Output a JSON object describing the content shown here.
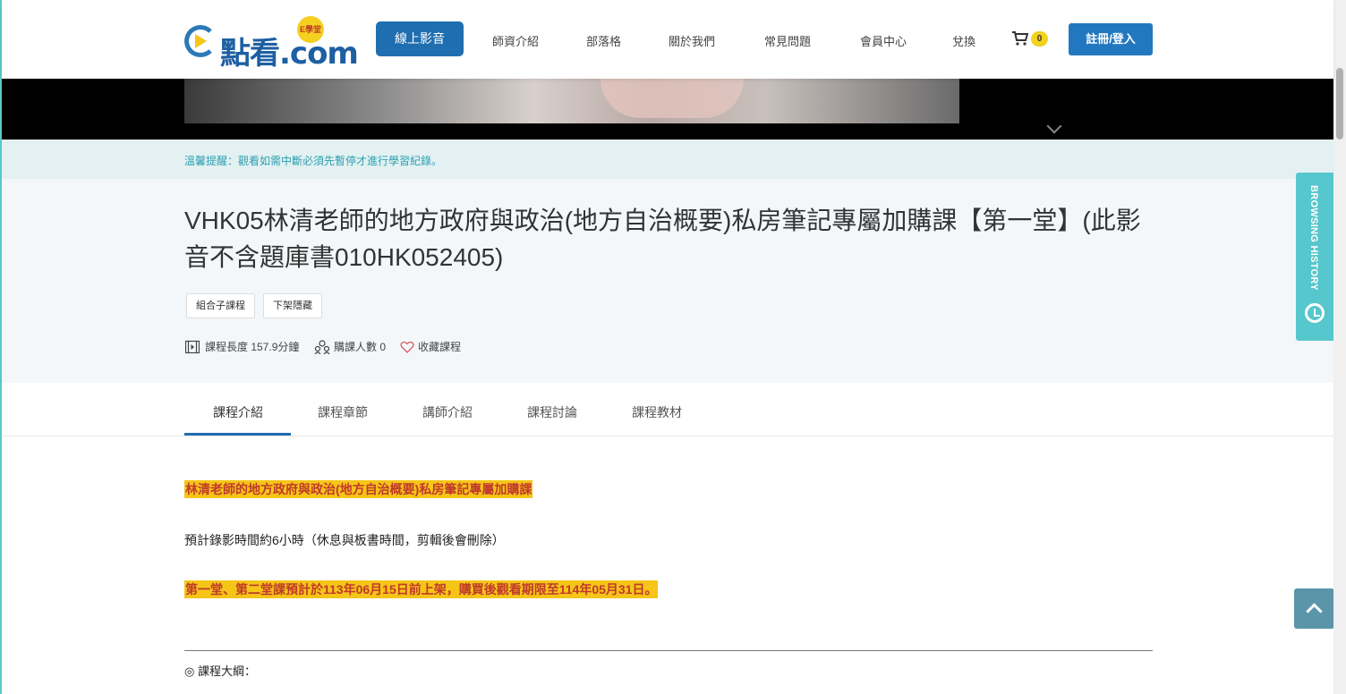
{
  "header": {
    "logo_text": "點看.com",
    "logo_badge": "E學堂",
    "nav_primary": "線上影音",
    "nav": [
      "師資介紹",
      "部落格",
      "關於我們",
      "常見問題",
      "會員中心",
      "兌換"
    ],
    "cart_count": "0",
    "login_label": "註冊/登入"
  },
  "reminder": "溫馨提醒：觀看如需中斷必須先暫停才進行學習紀錄。",
  "course": {
    "title": "VHK05林清老師的地方政府與政治(地方自治概要)私房筆記專屬加購課【第一堂】(此影音不含題庫書010HK052405)",
    "tags": [
      "組合子課程",
      "下架隱藏"
    ],
    "duration": "課程長度 157.9分鐘",
    "buyers": "購課人數 0",
    "favorite": "收藏課程"
  },
  "tabs": [
    "課程介紹",
    "課程章節",
    "講師介紹",
    "課程討論",
    "課程教材"
  ],
  "content": {
    "line1": "林清老師的地方政府與政治(地方自治概要)私房筆記專屬加購課",
    "line2": "預計錄影時間約6小時（休息與板書時間，剪輯後會刪除）",
    "line3": "第一堂、第二堂課預計於113年06月15日前上架，購買後觀看期限至114年05月31日。",
    "outline": "◎ 課程大綱："
  },
  "history_label": "BROWSING HISTORY",
  "colors": {
    "primary": "#1f6eb0",
    "highlight": "#f5c518",
    "highlight_text": "#c0392b",
    "teal": "#56c7cc"
  }
}
